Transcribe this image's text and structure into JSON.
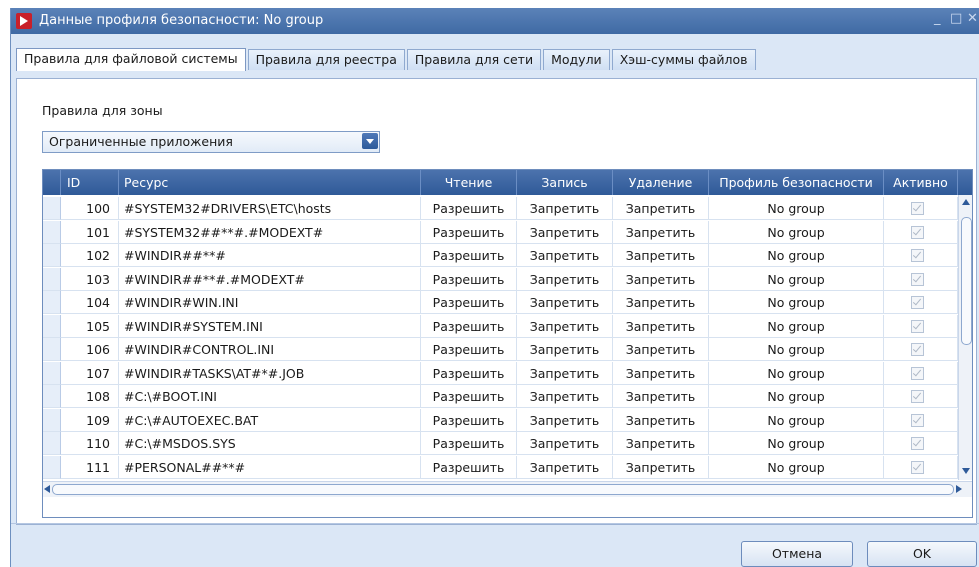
{
  "window": {
    "title": "Данные профиля безопасности: No group",
    "controls": {
      "minimize": "_",
      "maximize": "□",
      "close": "✕"
    }
  },
  "tabs": [
    {
      "label": "Правила для файловой системы",
      "active": true
    },
    {
      "label": "Правила для реестра",
      "active": false
    },
    {
      "label": "Правила для сети",
      "active": false
    },
    {
      "label": "Модули",
      "active": false
    },
    {
      "label": "Хэш-суммы файлов",
      "active": false
    }
  ],
  "zone": {
    "label": "Правила для зоны",
    "selected": "Ограниченные приложения"
  },
  "grid": {
    "columns": [
      "ID",
      "Ресурс",
      "Чтение",
      "Запись",
      "Удаление",
      "Профиль безопасности",
      "Активно"
    ],
    "rows": [
      {
        "id": "100",
        "resource": "#SYSTEM32#DRIVERS\\ETC\\hosts",
        "read": "Разрешить",
        "write": "Запретить",
        "delete": "Запретить",
        "profile": "No group",
        "active": true
      },
      {
        "id": "101",
        "resource": "#SYSTEM32##**#.#MODEXT#",
        "read": "Разрешить",
        "write": "Запретить",
        "delete": "Запретить",
        "profile": "No group",
        "active": true
      },
      {
        "id": "102",
        "resource": "#WINDIR##**#",
        "read": "Разрешить",
        "write": "Запретить",
        "delete": "Запретить",
        "profile": "No group",
        "active": true
      },
      {
        "id": "103",
        "resource": "#WINDIR##**#.#MODEXT#",
        "read": "Разрешить",
        "write": "Запретить",
        "delete": "Запретить",
        "profile": "No group",
        "active": true
      },
      {
        "id": "104",
        "resource": "#WINDIR#WIN.INI",
        "read": "Разрешить",
        "write": "Запретить",
        "delete": "Запретить",
        "profile": "No group",
        "active": true
      },
      {
        "id": "105",
        "resource": "#WINDIR#SYSTEM.INI",
        "read": "Разрешить",
        "write": "Запретить",
        "delete": "Запретить",
        "profile": "No group",
        "active": true
      },
      {
        "id": "106",
        "resource": "#WINDIR#CONTROL.INI",
        "read": "Разрешить",
        "write": "Запретить",
        "delete": "Запретить",
        "profile": "No group",
        "active": true
      },
      {
        "id": "107",
        "resource": "#WINDIR#TASKS\\AT#*#.JOB",
        "read": "Разрешить",
        "write": "Запретить",
        "delete": "Запретить",
        "profile": "No group",
        "active": true
      },
      {
        "id": "108",
        "resource": "#C:\\#BOOT.INI",
        "read": "Разрешить",
        "write": "Запретить",
        "delete": "Запретить",
        "profile": "No group",
        "active": true
      },
      {
        "id": "109",
        "resource": "#C:\\#AUTOEXEC.BAT",
        "read": "Разрешить",
        "write": "Запретить",
        "delete": "Запретить",
        "profile": "No group",
        "active": true
      },
      {
        "id": "110",
        "resource": "#C:\\#MSDOS.SYS",
        "read": "Разрешить",
        "write": "Запретить",
        "delete": "Запретить",
        "profile": "No group",
        "active": true
      },
      {
        "id": "111",
        "resource": "#PERSONAL##**#",
        "read": "Разрешить",
        "write": "Запретить",
        "delete": "Запретить",
        "profile": "No group",
        "active": true
      }
    ]
  },
  "buttons": {
    "cancel": "Отмена",
    "ok": "OK"
  }
}
